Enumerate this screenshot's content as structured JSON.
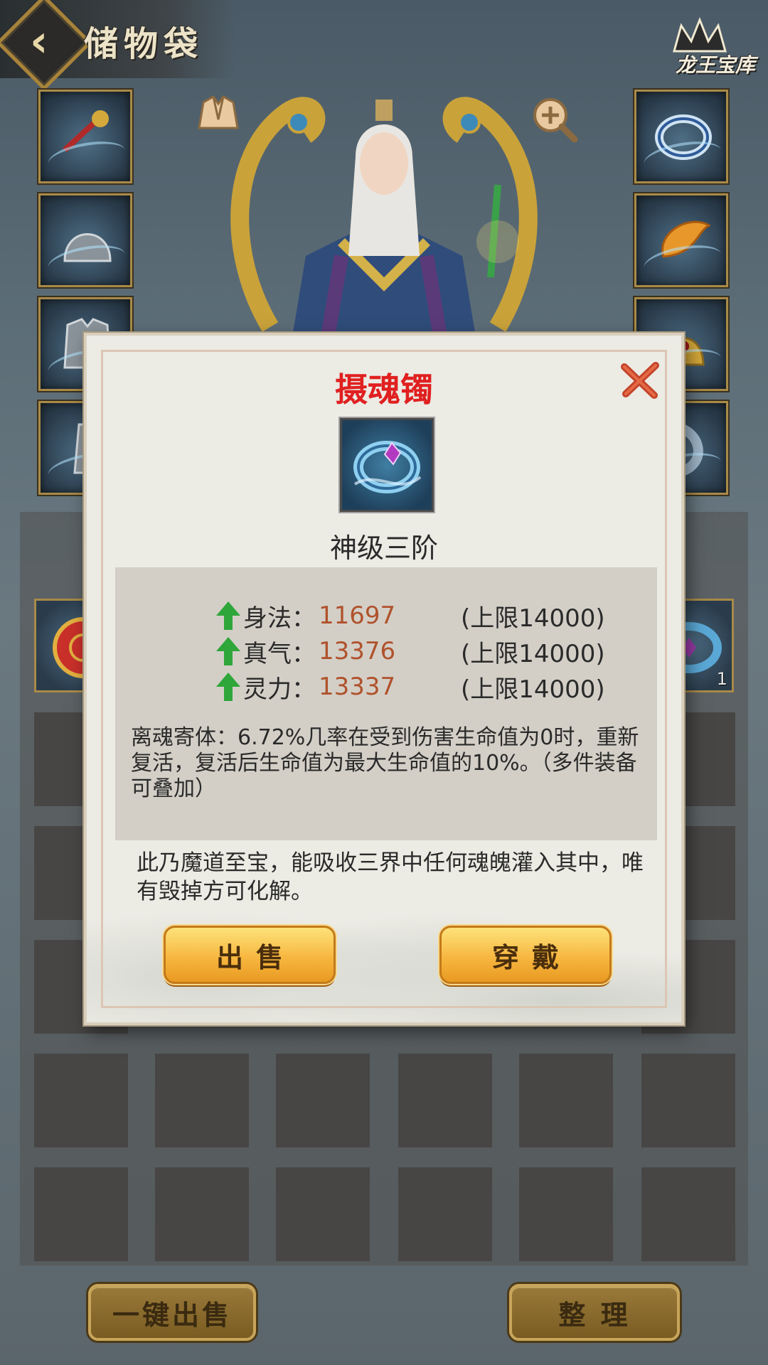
{
  "header": {
    "title": "储物袋",
    "treasury_label": "龙王宝库"
  },
  "inventory": {
    "stack_count": "1"
  },
  "bottom_buttons": {
    "sell_all": "一键出售",
    "sort": "整 理"
  },
  "modal": {
    "title": "摄魂镯",
    "grade": "神级三阶",
    "stats": [
      {
        "name": "身法：",
        "value": "11697",
        "limit": "(上限14000)"
      },
      {
        "name": "真气：",
        "value": "13376",
        "limit": "(上限14000)"
      },
      {
        "name": "灵力：",
        "value": "13337",
        "limit": "(上限14000)"
      }
    ],
    "special": "离魂寄体：6.72%几率在受到伤害生命值为0时，重新复活，复活后生命值为最大生命值的10%。（多件装备可叠加）",
    "flavor": "此乃魔道至宝，能吸收三界中任何魂魄灌入其中，唯有毁掉方可化解。",
    "sell_button": "出售",
    "wear_button": "穿戴"
  },
  "colors": {
    "title_red": "#e02020",
    "stat_value": "#b0522c",
    "arrow_green": "#2fa63a"
  },
  "icons": [
    "back-arrow-icon",
    "treasury-icon",
    "armor-toggle-icon",
    "zoom-in-icon",
    "close-icon",
    "stat-up-arrow-icon"
  ]
}
